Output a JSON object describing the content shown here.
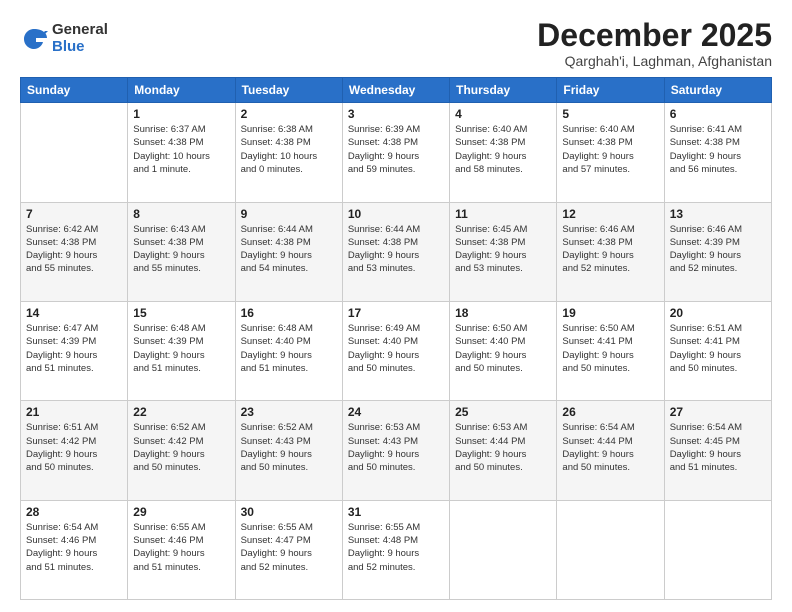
{
  "logo": {
    "general": "General",
    "blue": "Blue"
  },
  "header": {
    "month": "December 2025",
    "location": "Qarghah'i, Laghman, Afghanistan"
  },
  "weekdays": [
    "Sunday",
    "Monday",
    "Tuesday",
    "Wednesday",
    "Thursday",
    "Friday",
    "Saturday"
  ],
  "weeks": [
    [
      {
        "day": "",
        "info": ""
      },
      {
        "day": "1",
        "info": "Sunrise: 6:37 AM\nSunset: 4:38 PM\nDaylight: 10 hours\nand 1 minute."
      },
      {
        "day": "2",
        "info": "Sunrise: 6:38 AM\nSunset: 4:38 PM\nDaylight: 10 hours\nand 0 minutes."
      },
      {
        "day": "3",
        "info": "Sunrise: 6:39 AM\nSunset: 4:38 PM\nDaylight: 9 hours\nand 59 minutes."
      },
      {
        "day": "4",
        "info": "Sunrise: 6:40 AM\nSunset: 4:38 PM\nDaylight: 9 hours\nand 58 minutes."
      },
      {
        "day": "5",
        "info": "Sunrise: 6:40 AM\nSunset: 4:38 PM\nDaylight: 9 hours\nand 57 minutes."
      },
      {
        "day": "6",
        "info": "Sunrise: 6:41 AM\nSunset: 4:38 PM\nDaylight: 9 hours\nand 56 minutes."
      }
    ],
    [
      {
        "day": "7",
        "info": "Sunrise: 6:42 AM\nSunset: 4:38 PM\nDaylight: 9 hours\nand 55 minutes."
      },
      {
        "day": "8",
        "info": "Sunrise: 6:43 AM\nSunset: 4:38 PM\nDaylight: 9 hours\nand 55 minutes."
      },
      {
        "day": "9",
        "info": "Sunrise: 6:44 AM\nSunset: 4:38 PM\nDaylight: 9 hours\nand 54 minutes."
      },
      {
        "day": "10",
        "info": "Sunrise: 6:44 AM\nSunset: 4:38 PM\nDaylight: 9 hours\nand 53 minutes."
      },
      {
        "day": "11",
        "info": "Sunrise: 6:45 AM\nSunset: 4:38 PM\nDaylight: 9 hours\nand 53 minutes."
      },
      {
        "day": "12",
        "info": "Sunrise: 6:46 AM\nSunset: 4:38 PM\nDaylight: 9 hours\nand 52 minutes."
      },
      {
        "day": "13",
        "info": "Sunrise: 6:46 AM\nSunset: 4:39 PM\nDaylight: 9 hours\nand 52 minutes."
      }
    ],
    [
      {
        "day": "14",
        "info": "Sunrise: 6:47 AM\nSunset: 4:39 PM\nDaylight: 9 hours\nand 51 minutes."
      },
      {
        "day": "15",
        "info": "Sunrise: 6:48 AM\nSunset: 4:39 PM\nDaylight: 9 hours\nand 51 minutes."
      },
      {
        "day": "16",
        "info": "Sunrise: 6:48 AM\nSunset: 4:40 PM\nDaylight: 9 hours\nand 51 minutes."
      },
      {
        "day": "17",
        "info": "Sunrise: 6:49 AM\nSunset: 4:40 PM\nDaylight: 9 hours\nand 50 minutes."
      },
      {
        "day": "18",
        "info": "Sunrise: 6:50 AM\nSunset: 4:40 PM\nDaylight: 9 hours\nand 50 minutes."
      },
      {
        "day": "19",
        "info": "Sunrise: 6:50 AM\nSunset: 4:41 PM\nDaylight: 9 hours\nand 50 minutes."
      },
      {
        "day": "20",
        "info": "Sunrise: 6:51 AM\nSunset: 4:41 PM\nDaylight: 9 hours\nand 50 minutes."
      }
    ],
    [
      {
        "day": "21",
        "info": "Sunrise: 6:51 AM\nSunset: 4:42 PM\nDaylight: 9 hours\nand 50 minutes."
      },
      {
        "day": "22",
        "info": "Sunrise: 6:52 AM\nSunset: 4:42 PM\nDaylight: 9 hours\nand 50 minutes."
      },
      {
        "day": "23",
        "info": "Sunrise: 6:52 AM\nSunset: 4:43 PM\nDaylight: 9 hours\nand 50 minutes."
      },
      {
        "day": "24",
        "info": "Sunrise: 6:53 AM\nSunset: 4:43 PM\nDaylight: 9 hours\nand 50 minutes."
      },
      {
        "day": "25",
        "info": "Sunrise: 6:53 AM\nSunset: 4:44 PM\nDaylight: 9 hours\nand 50 minutes."
      },
      {
        "day": "26",
        "info": "Sunrise: 6:54 AM\nSunset: 4:44 PM\nDaylight: 9 hours\nand 50 minutes."
      },
      {
        "day": "27",
        "info": "Sunrise: 6:54 AM\nSunset: 4:45 PM\nDaylight: 9 hours\nand 51 minutes."
      }
    ],
    [
      {
        "day": "28",
        "info": "Sunrise: 6:54 AM\nSunset: 4:46 PM\nDaylight: 9 hours\nand 51 minutes."
      },
      {
        "day": "29",
        "info": "Sunrise: 6:55 AM\nSunset: 4:46 PM\nDaylight: 9 hours\nand 51 minutes."
      },
      {
        "day": "30",
        "info": "Sunrise: 6:55 AM\nSunset: 4:47 PM\nDaylight: 9 hours\nand 52 minutes."
      },
      {
        "day": "31",
        "info": "Sunrise: 6:55 AM\nSunset: 4:48 PM\nDaylight: 9 hours\nand 52 minutes."
      },
      {
        "day": "",
        "info": ""
      },
      {
        "day": "",
        "info": ""
      },
      {
        "day": "",
        "info": ""
      }
    ]
  ]
}
